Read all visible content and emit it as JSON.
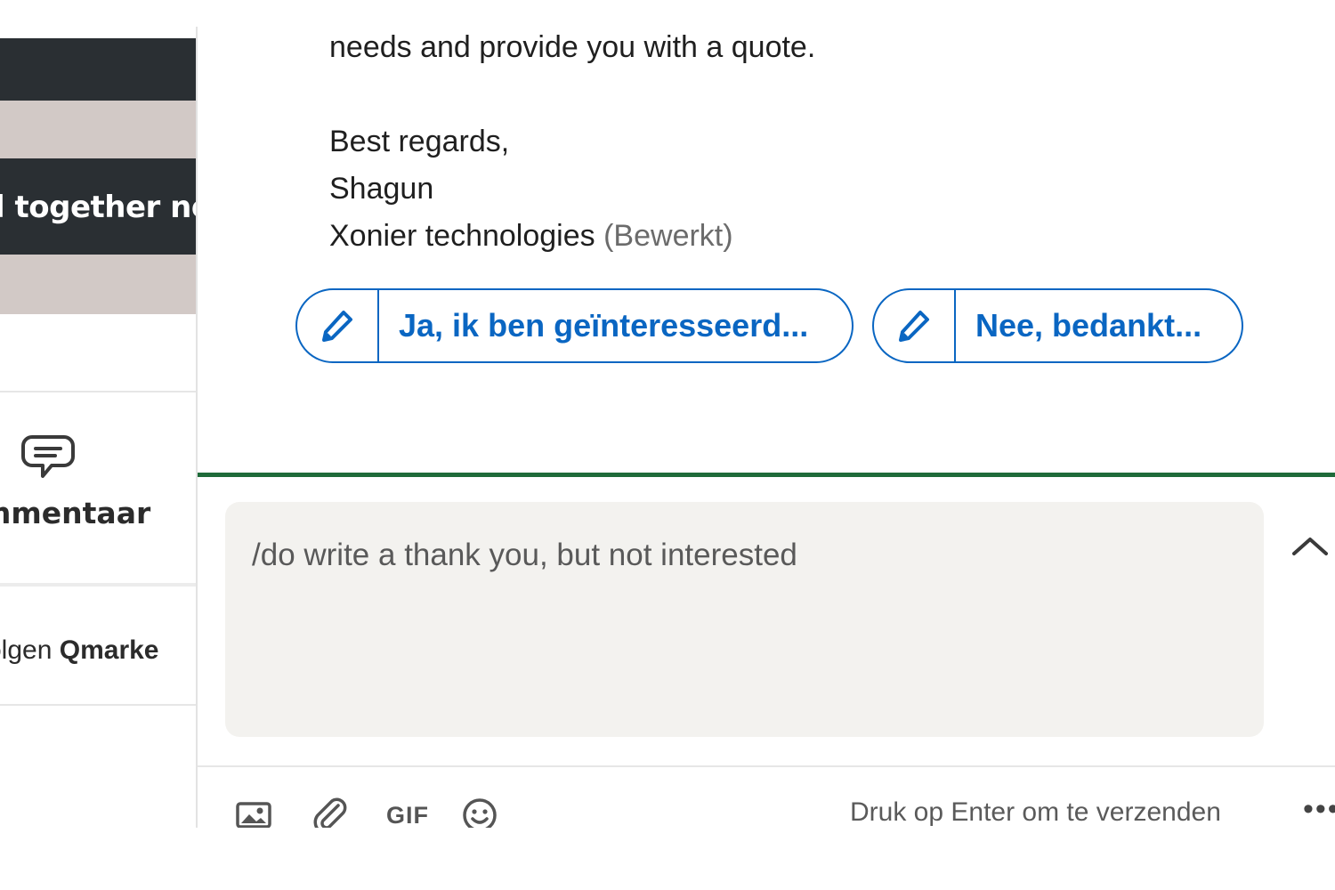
{
  "feed": {
    "banner_text": "l together now",
    "comment_label": "mmentaar",
    "follow_prefix": "volgen ",
    "follow_name": "Qmarke"
  },
  "message": {
    "lines": [
      "needs and provide you with a quote.",
      "Best regards,",
      "Shagun",
      "Xonier technologies"
    ],
    "edited_label": "(Bewerkt)"
  },
  "smart_replies": [
    {
      "label": "Ja, ik ben geïnteresseerd..."
    },
    {
      "label": "Nee, bedankt..."
    }
  ],
  "composer": {
    "text": "/do write a thank you, but not interested",
    "toolbar": {
      "gif_label": "GIF",
      "send_hint": "Druk op Enter om te verzenden",
      "more_label": "•••"
    }
  },
  "colors": {
    "accent": "#0a66c2",
    "compose_border": "#1f6b3a",
    "compose_bg": "#f3f2ef"
  }
}
